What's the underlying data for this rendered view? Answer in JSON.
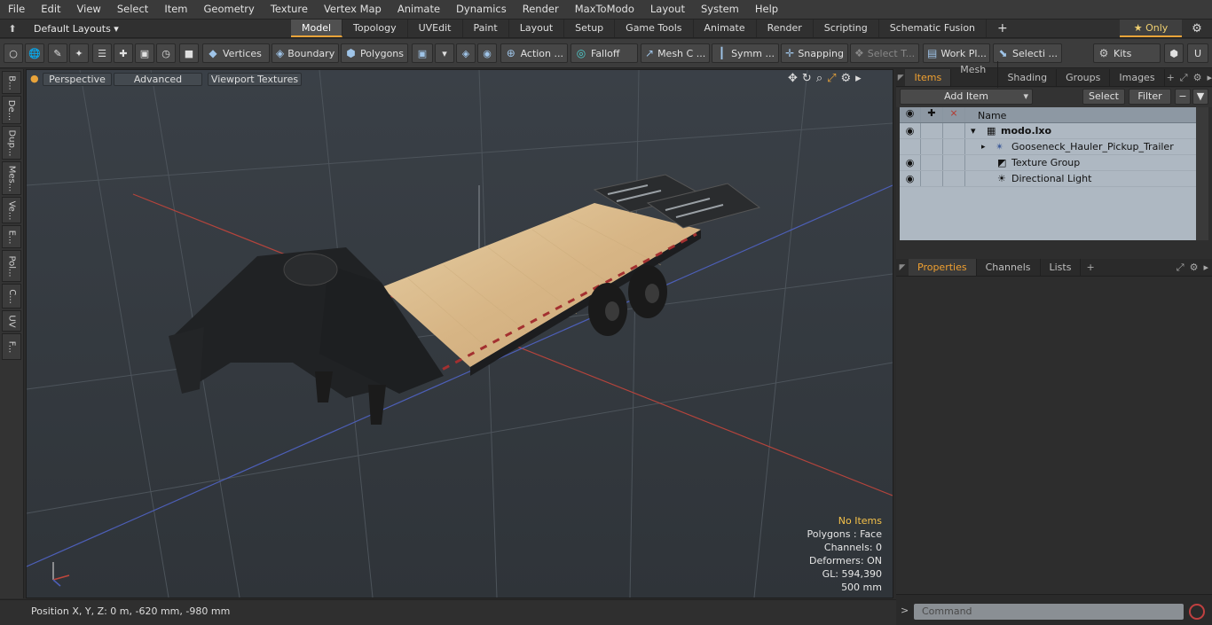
{
  "menu": [
    "File",
    "Edit",
    "View",
    "Select",
    "Item",
    "Geometry",
    "Texture",
    "Vertex Map",
    "Animate",
    "Dynamics",
    "Render",
    "MaxToModo",
    "Layout",
    "System",
    "Help"
  ],
  "layout_bar": {
    "layout_label": "Default Layouts ▾",
    "tabs": [
      "Model",
      "Topology",
      "UVEdit",
      "Paint",
      "Layout",
      "Setup",
      "Game Tools",
      "Animate",
      "Render",
      "Scripting",
      "Schematic Fusion"
    ],
    "active_tab": "Model",
    "plus": "+",
    "only_label": "★ Only"
  },
  "toolbar": {
    "vertices": "Vertices",
    "boundary": "Boundary",
    "polygons": "Polygons",
    "action": "Action ...",
    "falloff": "Falloff",
    "mesh": "Mesh C ...",
    "symm": "Symm ...",
    "snapping": "Snapping",
    "select_t": "Select T...",
    "work_pl": "Work Pl...",
    "selecti": "Selecti ...",
    "kits": "Kits"
  },
  "left_tabs": [
    "B...",
    "De...",
    "Dup...",
    "Mes...",
    "Ve...",
    "E...",
    "Pol...",
    "C...",
    "UV",
    "F..."
  ],
  "viewport": {
    "perspective": "Perspective",
    "advanced": "Advanced",
    "viewport_textures": "Viewport Textures",
    "stats": {
      "no_items": "No Items",
      "polygons": "Polygons : Face",
      "channels": "Channels: 0",
      "deformers": "Deformers: ON",
      "gl": "GL: 594,390",
      "scale": "500 mm"
    }
  },
  "status": {
    "position": "Position X, Y, Z:   0 m, -620 mm, -980 mm"
  },
  "items_panel": {
    "tabs": [
      "Items",
      "Mesh ...",
      "Shading",
      "Groups",
      "Images"
    ],
    "active_tab": "Items",
    "add_item": "Add Item",
    "select": "Select",
    "filter": "Filter",
    "name_header": "Name",
    "rows": [
      {
        "name": "modo.lxo",
        "bold": true
      },
      {
        "name": "Gooseneck_Hauler_Pickup_Trailer",
        "bold": false
      },
      {
        "name": "Texture Group",
        "bold": false
      },
      {
        "name": "Directional Light",
        "bold": false
      }
    ]
  },
  "properties_panel": {
    "tabs": [
      "Properties",
      "Channels",
      "Lists"
    ],
    "active_tab": "Properties",
    "plus": "+"
  },
  "command": {
    "placeholder": "Command"
  },
  "colors": {
    "accent": "#e8a33a",
    "viewport_bg": "#34393f",
    "deck": "#d9b98a",
    "trailer": "#222426"
  }
}
